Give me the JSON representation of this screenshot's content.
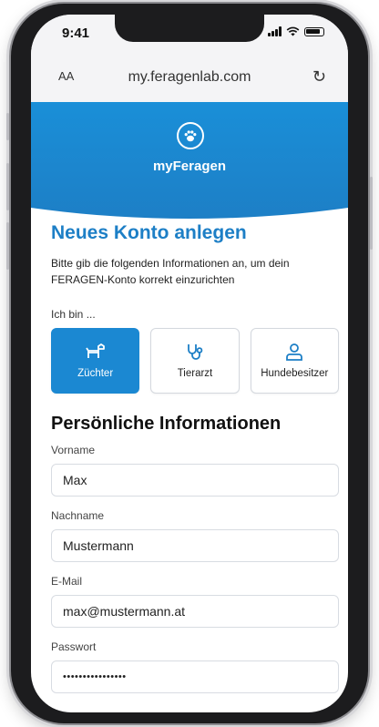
{
  "status_bar": {
    "time": "9:41"
  },
  "browser": {
    "text_size_label": "AA",
    "url": "my.feragenlab.com"
  },
  "header": {
    "brand": "myFeragen"
  },
  "form": {
    "title": "Neues Konto anlegen",
    "intro": "Bitte gib die folgenden Informationen an, um dein FERAGEN-Konto korrekt einzurichten",
    "role_prompt": "Ich bin ...",
    "roles": [
      {
        "label": "Züchter",
        "icon": "dog-icon",
        "selected": true
      },
      {
        "label": "Tierarzt",
        "icon": "stethoscope-icon",
        "selected": false
      },
      {
        "label": "Hundebesitzer",
        "icon": "user-icon",
        "selected": false
      }
    ],
    "section_title": "Persönliche Informationen",
    "fields": {
      "first_name": {
        "label": "Vorname",
        "value": "Max"
      },
      "last_name": {
        "label": "Nachname",
        "value": "Mustermann"
      },
      "email": {
        "label": "E-Mail",
        "value": "max@mustermann.at"
      },
      "password": {
        "label": "Passwort",
        "value": "••••••••••••••••"
      }
    }
  },
  "colors": {
    "accent": "#1d7fc6",
    "selected_role": "#1b88d2"
  }
}
